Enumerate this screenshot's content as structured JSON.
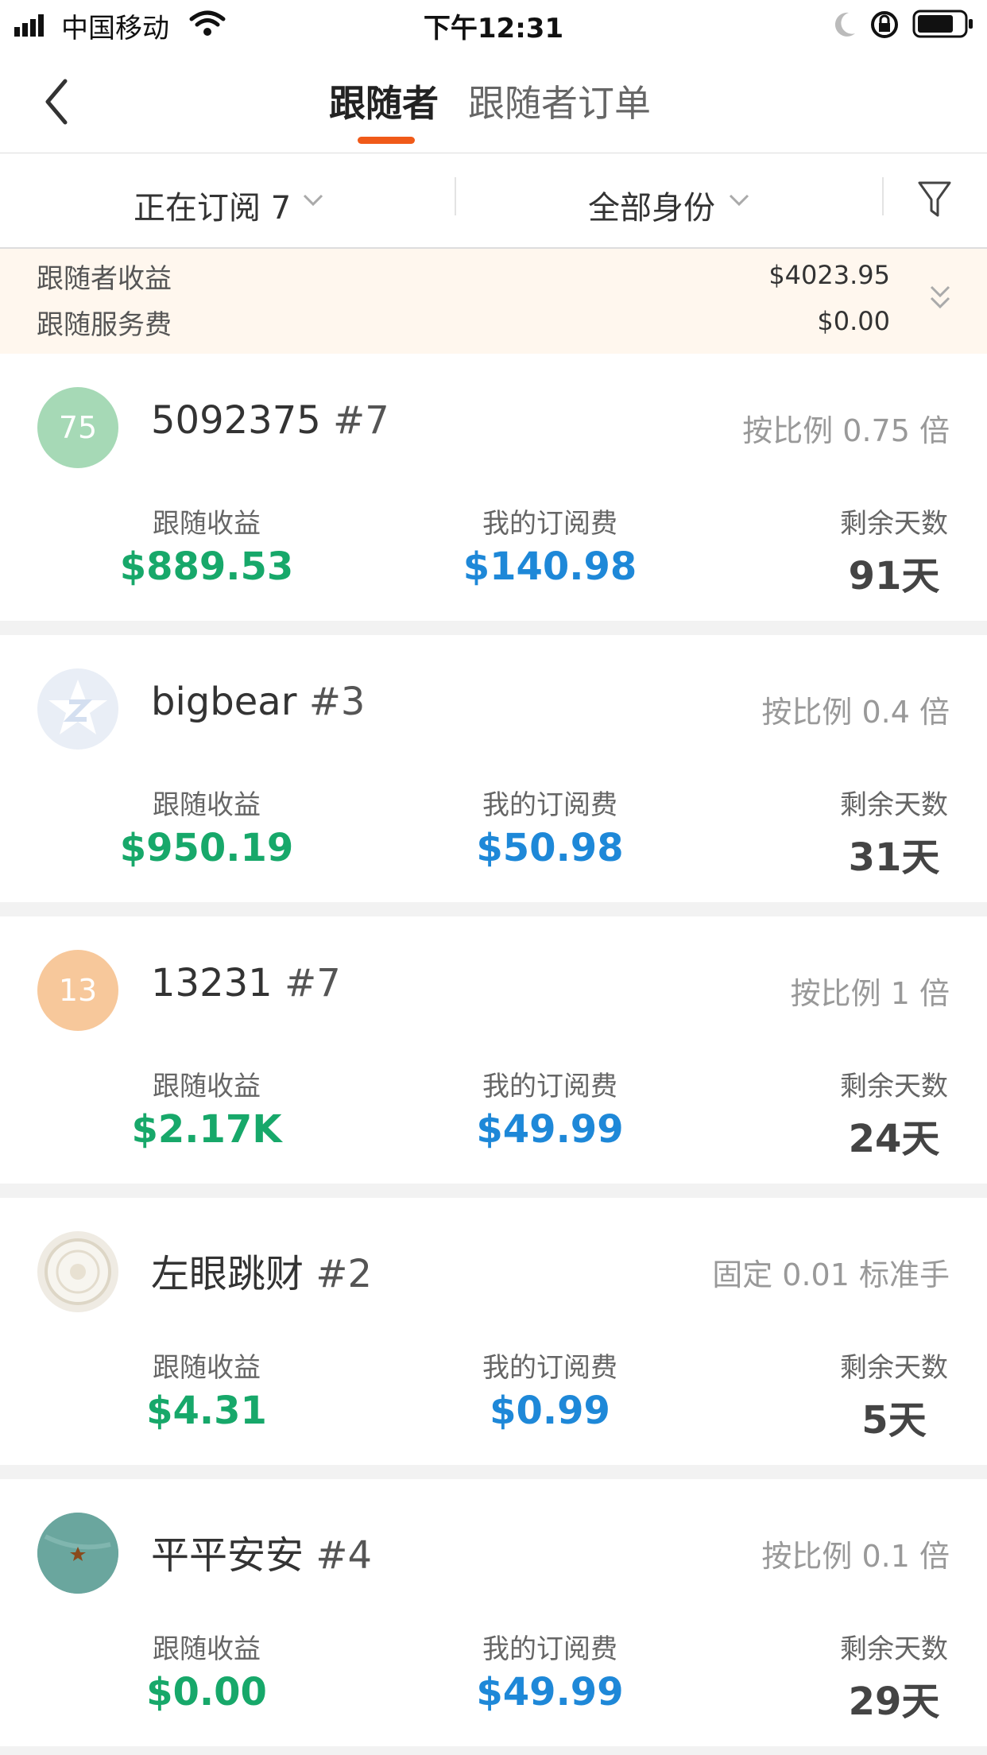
{
  "status_bar": {
    "carrier": "中国移动",
    "time": "下午12:31"
  },
  "nav": {
    "tab_followers": "跟随者",
    "tab_orders": "跟随者订单"
  },
  "filters": {
    "subscribing": "正在订阅 7",
    "identity": "全部身份"
  },
  "summary": {
    "earnings_label": "跟随者收益",
    "earnings_value": "$4023.95",
    "fee_label": "跟随服务费",
    "fee_value": "$0.00"
  },
  "labels": {
    "earnings": "跟随收益",
    "fee": "我的订阅费",
    "days": "剩余天数"
  },
  "colors": {
    "accent": "#f05a19",
    "earnings": "#17a86a",
    "fee": "#1e88d8"
  },
  "followers": [
    {
      "avatar_text": "75",
      "avatar_color": "#a6d9b6",
      "name": "5092375",
      "tag": "#7",
      "mode": "按比例 0.75 倍",
      "earnings": "$889.53",
      "fee": "$140.98",
      "days": "91天"
    },
    {
      "avatar_text": "",
      "avatar_color": "#e9eef6",
      "name": "bigbear",
      "tag": "#3",
      "mode": "按比例 0.4 倍",
      "earnings": "$950.19",
      "fee": "$50.98",
      "days": "31天"
    },
    {
      "avatar_text": "13",
      "avatar_color": "#f7c89b",
      "name": "13231",
      "tag": "#7",
      "mode": "按比例 1 倍",
      "earnings": "$2.17K",
      "fee": "$49.99",
      "days": "24天"
    },
    {
      "avatar_text": "",
      "avatar_color": "#efebe3",
      "name": "左眼跳财",
      "tag": "#2",
      "mode": "固定 0.01 标准手",
      "earnings": "$4.31",
      "fee": "$0.99",
      "days": "5天"
    },
    {
      "avatar_text": "",
      "avatar_color": "#5f9c95",
      "name": "平平安安",
      "tag": "#4",
      "mode": "按比例 0.1 倍",
      "earnings": "$0.00",
      "fee": "$49.99",
      "days": "29天"
    }
  ]
}
